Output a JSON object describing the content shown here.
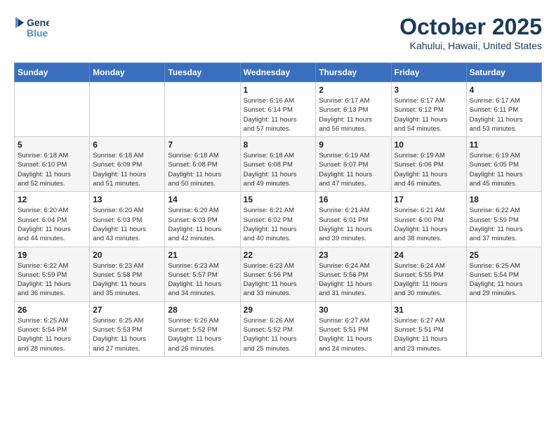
{
  "header": {
    "logo_line1": "General",
    "logo_line2": "Blue",
    "month": "October 2025",
    "location": "Kahului, Hawaii, United States"
  },
  "weekdays": [
    "Sunday",
    "Monday",
    "Tuesday",
    "Wednesday",
    "Thursday",
    "Friday",
    "Saturday"
  ],
  "weeks": [
    [
      {
        "day": "",
        "info": ""
      },
      {
        "day": "",
        "info": ""
      },
      {
        "day": "",
        "info": ""
      },
      {
        "day": "1",
        "info": "Sunrise: 6:16 AM\nSunset: 6:14 PM\nDaylight: 11 hours\nand 57 minutes."
      },
      {
        "day": "2",
        "info": "Sunrise: 6:17 AM\nSunset: 6:13 PM\nDaylight: 11 hours\nand 56 minutes."
      },
      {
        "day": "3",
        "info": "Sunrise: 6:17 AM\nSunset: 6:12 PM\nDaylight: 11 hours\nand 54 minutes."
      },
      {
        "day": "4",
        "info": "Sunrise: 6:17 AM\nSunset: 6:11 PM\nDaylight: 11 hours\nand 53 minutes."
      }
    ],
    [
      {
        "day": "5",
        "info": "Sunrise: 6:18 AM\nSunset: 6:10 PM\nDaylight: 11 hours\nand 52 minutes."
      },
      {
        "day": "6",
        "info": "Sunrise: 6:18 AM\nSunset: 6:09 PM\nDaylight: 11 hours\nand 51 minutes."
      },
      {
        "day": "7",
        "info": "Sunrise: 6:18 AM\nSunset: 6:08 PM\nDaylight: 11 hours\nand 50 minutes."
      },
      {
        "day": "8",
        "info": "Sunrise: 6:18 AM\nSunset: 6:08 PM\nDaylight: 11 hours\nand 49 minutes."
      },
      {
        "day": "9",
        "info": "Sunrise: 6:19 AM\nSunset: 6:07 PM\nDaylight: 11 hours\nand 47 minutes."
      },
      {
        "day": "10",
        "info": "Sunrise: 6:19 AM\nSunset: 6:06 PM\nDaylight: 11 hours\nand 46 minutes."
      },
      {
        "day": "11",
        "info": "Sunrise: 6:19 AM\nSunset: 6:05 PM\nDaylight: 11 hours\nand 45 minutes."
      }
    ],
    [
      {
        "day": "12",
        "info": "Sunrise: 6:20 AM\nSunset: 6:04 PM\nDaylight: 11 hours\nand 44 minutes."
      },
      {
        "day": "13",
        "info": "Sunrise: 6:20 AM\nSunset: 6:03 PM\nDaylight: 11 hours\nand 43 minutes."
      },
      {
        "day": "14",
        "info": "Sunrise: 6:20 AM\nSunset: 6:03 PM\nDaylight: 11 hours\nand 42 minutes."
      },
      {
        "day": "15",
        "info": "Sunrise: 6:21 AM\nSunset: 6:02 PM\nDaylight: 11 hours\nand 40 minutes."
      },
      {
        "day": "16",
        "info": "Sunrise: 6:21 AM\nSunset: 6:01 PM\nDaylight: 11 hours\nand 39 minutes."
      },
      {
        "day": "17",
        "info": "Sunrise: 6:21 AM\nSunset: 6:00 PM\nDaylight: 11 hours\nand 38 minutes."
      },
      {
        "day": "18",
        "info": "Sunrise: 6:22 AM\nSunset: 5:59 PM\nDaylight: 11 hours\nand 37 minutes."
      }
    ],
    [
      {
        "day": "19",
        "info": "Sunrise: 6:22 AM\nSunset: 5:59 PM\nDaylight: 11 hours\nand 36 minutes."
      },
      {
        "day": "20",
        "info": "Sunrise: 6:23 AM\nSunset: 5:58 PM\nDaylight: 11 hours\nand 35 minutes."
      },
      {
        "day": "21",
        "info": "Sunrise: 6:23 AM\nSunset: 5:57 PM\nDaylight: 11 hours\nand 34 minutes."
      },
      {
        "day": "22",
        "info": "Sunrise: 6:23 AM\nSunset: 5:56 PM\nDaylight: 11 hours\nand 33 minutes."
      },
      {
        "day": "23",
        "info": "Sunrise: 6:24 AM\nSunset: 5:56 PM\nDaylight: 11 hours\nand 31 minutes."
      },
      {
        "day": "24",
        "info": "Sunrise: 6:24 AM\nSunset: 5:55 PM\nDaylight: 11 hours\nand 30 minutes."
      },
      {
        "day": "25",
        "info": "Sunrise: 6:25 AM\nSunset: 5:54 PM\nDaylight: 11 hours\nand 29 minutes."
      }
    ],
    [
      {
        "day": "26",
        "info": "Sunrise: 6:25 AM\nSunset: 5:54 PM\nDaylight: 11 hours\nand 28 minutes."
      },
      {
        "day": "27",
        "info": "Sunrise: 6:25 AM\nSunset: 5:53 PM\nDaylight: 11 hours\nand 27 minutes."
      },
      {
        "day": "28",
        "info": "Sunrise: 6:26 AM\nSunset: 5:52 PM\nDaylight: 11 hours\nand 26 minutes."
      },
      {
        "day": "29",
        "info": "Sunrise: 6:26 AM\nSunset: 5:52 PM\nDaylight: 11 hours\nand 25 minutes."
      },
      {
        "day": "30",
        "info": "Sunrise: 6:27 AM\nSunset: 5:51 PM\nDaylight: 11 hours\nand 24 minutes."
      },
      {
        "day": "31",
        "info": "Sunrise: 6:27 AM\nSunset: 5:51 PM\nDaylight: 11 hours\nand 23 minutes."
      },
      {
        "day": "",
        "info": ""
      }
    ]
  ]
}
